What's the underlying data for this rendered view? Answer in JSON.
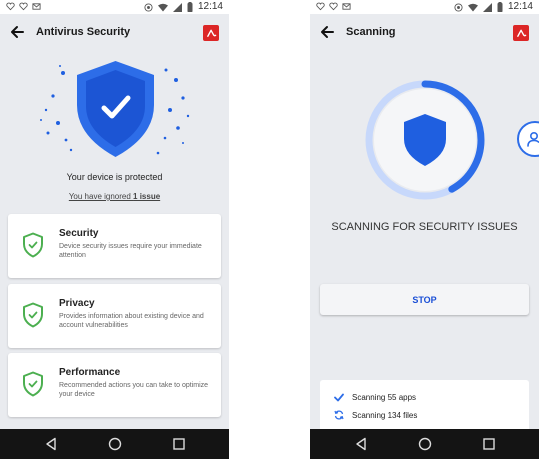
{
  "status_bar": {
    "time": "12:14"
  },
  "antivirus_screen": {
    "title": "Antivirus Security",
    "protection_status": "Your device is protected",
    "ignored_prefix": "You have ignored ",
    "ignored_count": "1 issue",
    "cards": [
      {
        "title": "Security",
        "description": "Device security issues require your immediate attention",
        "icon": "shield-check-icon"
      },
      {
        "title": "Privacy",
        "description": "Provides information about existing device and account vulnerabilities",
        "icon": "shield-check-icon"
      },
      {
        "title": "Performance",
        "description": "Recommended actions you can take to optimize your device",
        "icon": "shield-check-icon"
      }
    ]
  },
  "scanning_screen": {
    "title": "Scanning",
    "heading": "SCANNING FOR SECURITY ISSUES",
    "progress_fraction": 0.42,
    "stop_label": "STOP",
    "items": [
      {
        "label": "Scanning 55 apps",
        "icon": "check-icon"
      },
      {
        "label": "Scanning 134 files",
        "icon": "sync-icon"
      }
    ]
  },
  "colors": {
    "accent_blue": "#2d6de8",
    "shield_blue": "#1f5fe0",
    "check_green": "#4caf50",
    "brand_red": "#dc2626",
    "nav_bar": "#141414",
    "background": "#e9ebef"
  }
}
